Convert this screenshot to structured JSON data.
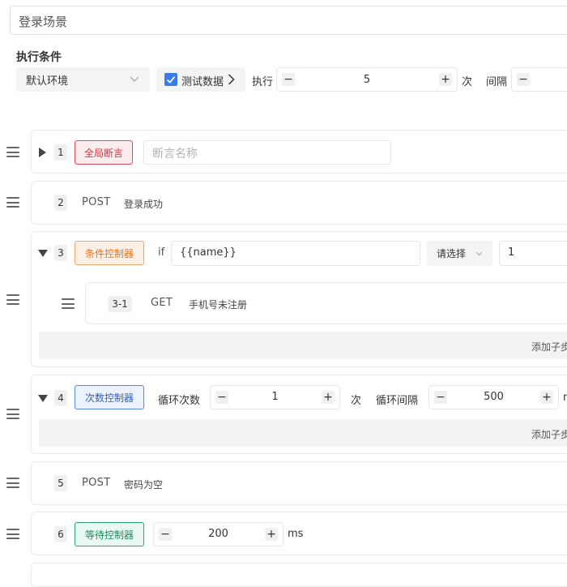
{
  "scenario": {
    "name": "登录场景"
  },
  "conditions": {
    "title": "执行条件",
    "environment": "默认环境",
    "test_data_label": "测试数据",
    "test_data_checked": true,
    "exec_label": "执行",
    "exec_count": "5",
    "exec_unit": "次",
    "interval_label": "间隔",
    "minus": "−",
    "plus": "+"
  },
  "steps": [
    {
      "num": "1",
      "tag": "全局断言",
      "placeholder": "断言名称"
    },
    {
      "num": "2",
      "method": "POST",
      "desc": "登录成功"
    },
    {
      "num": "3",
      "tag": "条件控制器",
      "if_label": "if",
      "expression": "{{name}}",
      "operator": "请选择",
      "value": "1",
      "children": [
        {
          "num": "3-1",
          "method": "GET",
          "desc": "手机号未注册"
        }
      ],
      "add_child": "添加子步"
    },
    {
      "num": "4",
      "tag": "次数控制器",
      "loop_label": "循环次数",
      "loop_count": "1",
      "loop_unit": "次",
      "interval_label": "循环间隔",
      "interval_value": "500",
      "interval_unit": "ms",
      "add_child": "添加子步"
    },
    {
      "num": "5",
      "method": "POST",
      "desc": "密码为空"
    },
    {
      "num": "6",
      "tag": "等待控制器",
      "wait_value": "200",
      "wait_unit": "ms"
    }
  ],
  "colors": {
    "accent": "#3a7cf0",
    "assert_tag": "#e34d59",
    "condition_tag": "#e37318",
    "count_tag": "#2f5fb8",
    "wait_tag": "#1f8a5c"
  }
}
